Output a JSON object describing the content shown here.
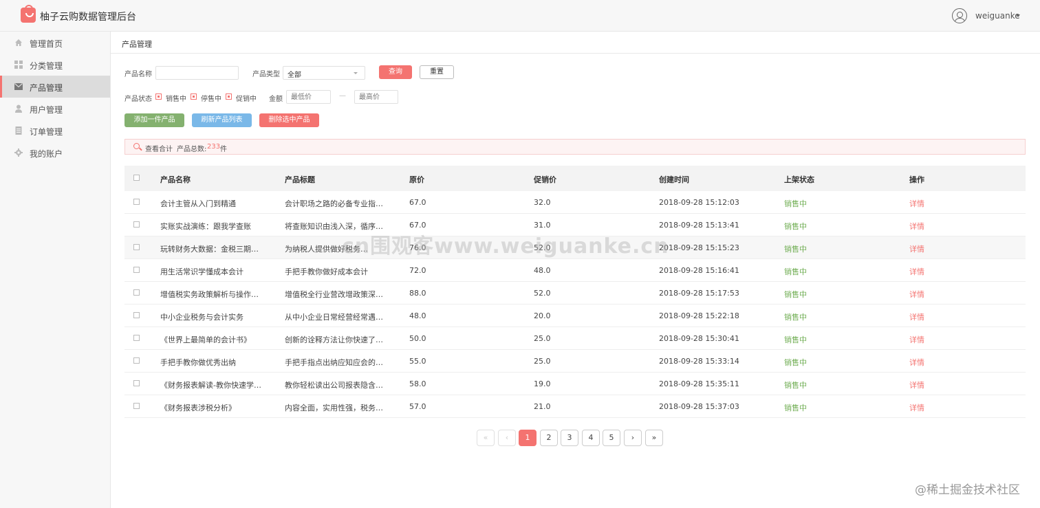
{
  "header": {
    "title": "柚子云购数据管理后台",
    "username": "weiguanke"
  },
  "sidebar": {
    "items": [
      {
        "label": "管理首页",
        "icon": "home-icon"
      },
      {
        "label": "分类管理",
        "icon": "grid-icon"
      },
      {
        "label": "产品管理",
        "icon": "envelope-icon",
        "active": true
      },
      {
        "label": "用户管理",
        "icon": "user-icon"
      },
      {
        "label": "订单管理",
        "icon": "document-icon"
      },
      {
        "label": "我的账户",
        "icon": "gear-icon"
      }
    ]
  },
  "breadcrumb": "产品管理",
  "filters": {
    "name_label": "产品名称",
    "name_value": "",
    "type_label": "产品类型",
    "type_value": "全部",
    "query_label": "查询",
    "reset_label": "重置",
    "status_label": "产品状态",
    "status_options": [
      "销售中",
      "停售中",
      "促销中"
    ],
    "amount_label": "金额",
    "min_placeholder": "最低价",
    "separator": "—",
    "max_placeholder": "最高价"
  },
  "actions": {
    "add_label": "添加一件产品",
    "refresh_label": "刷新产品列表",
    "delete_label": "删除选中产品"
  },
  "summary": {
    "label": "查看合计",
    "total_prefix": "产品总数:",
    "total_count": "233",
    "total_unit": "件"
  },
  "table": {
    "columns": [
      "产品名称",
      "产品标题",
      "原价",
      "促销价",
      "创建时间",
      "上架状态",
      "操作"
    ],
    "rows": [
      {
        "name": "会计主管从入门到精通",
        "title": "会计职场之路的必备专业指…",
        "price": "67.0",
        "promo": "32.0",
        "created": "2018-09-28 15:12:03",
        "status": "销售中",
        "op": "详情"
      },
      {
        "name": "实账实战演练：跟我学查账",
        "title": "将查账知识由浅入深，循序…",
        "price": "67.0",
        "promo": "31.0",
        "created": "2018-09-28 15:13:41",
        "status": "销售中",
        "op": "详情"
      },
      {
        "name": "玩转财务大数据：金税三期…",
        "title": "为纳税人提供做好税务…",
        "price": "76.0",
        "promo": "52.0",
        "created": "2018-09-28 15:15:23",
        "status": "销售中",
        "op": "详情"
      },
      {
        "name": "用生活常识学懂成本会计",
        "title": "手把手教你做好成本会计",
        "price": "72.0",
        "promo": "48.0",
        "created": "2018-09-28 15:16:41",
        "status": "销售中",
        "op": "详情"
      },
      {
        "name": "增值税实务政策解析与操作…",
        "title": "增值税全行业营改增政策深…",
        "price": "88.0",
        "promo": "52.0",
        "created": "2018-09-28 15:17:53",
        "status": "销售中",
        "op": "详情"
      },
      {
        "name": "中小企业税务与会计实务",
        "title": "从中小企业日常经营经常遇…",
        "price": "48.0",
        "promo": "20.0",
        "created": "2018-09-28 15:22:18",
        "status": "销售中",
        "op": "详情"
      },
      {
        "name": "《世界上最简单的会计书》",
        "title": "创新的诠释方法让你快速了…",
        "price": "50.0",
        "promo": "25.0",
        "created": "2018-09-28 15:30:41",
        "status": "销售中",
        "op": "详情"
      },
      {
        "name": "手把手教你做优秀出纳",
        "title": "手把手指点出纳应知应会的…",
        "price": "55.0",
        "promo": "25.0",
        "created": "2018-09-28 15:33:14",
        "status": "销售中",
        "op": "详情"
      },
      {
        "name": "《财务报表解读-教你快速学…",
        "title": "教你轻松读出公司报表隐含…",
        "price": "58.0",
        "promo": "19.0",
        "created": "2018-09-28 15:35:11",
        "status": "销售中",
        "op": "详情"
      },
      {
        "name": "《财务报表涉税分析》",
        "title": "内容全面，实用性强，税务…",
        "price": "57.0",
        "promo": "21.0",
        "created": "2018-09-28 15:37:03",
        "status": "销售中",
        "op": "详情"
      }
    ]
  },
  "pagination": {
    "first": "«",
    "prev": "‹",
    "pages": [
      "1",
      "2",
      "3",
      "4",
      "5"
    ],
    "current": "1",
    "next": "›",
    "last": "»"
  },
  "watermark": "cn围观客www.weiguanke.cn",
  "credit": "@稀土掘金技术社区",
  "colors": {
    "accent": "#f47370",
    "success": "#84b16f",
    "info": "#7ab8e8",
    "status_green": "#6fad52"
  }
}
